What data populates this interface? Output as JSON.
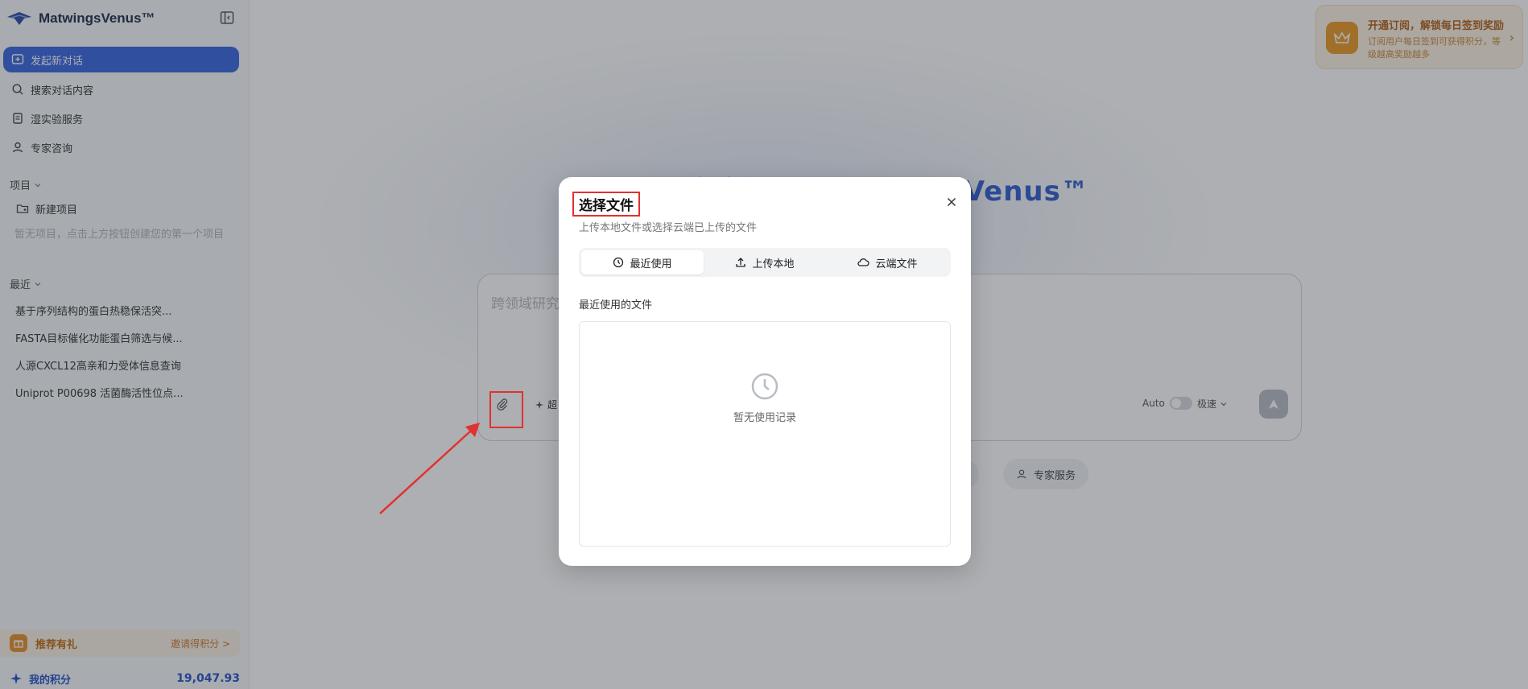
{
  "app": {
    "name": "MatwingsVenus™"
  },
  "sidebar": {
    "nav": [
      {
        "label": "发起新对话",
        "icon": "new-chat-icon"
      },
      {
        "label": "搜索对话内容",
        "icon": "search-icon"
      },
      {
        "label": "湿实验服务",
        "icon": "document-icon"
      },
      {
        "label": "专家咨询",
        "icon": "user-icon"
      }
    ],
    "projects": {
      "heading": "项目",
      "new_label": "新建项目",
      "empty_hint": "暂无项目，点击上方按钮创建您的第一个项目"
    },
    "recent": {
      "heading": "最近",
      "items": [
        "基于序列结构的蛋白热稳保活突...",
        "FASTA目标催化功能蛋白筛选与候...",
        "人源CXCL12高亲和力受体信息查询",
        "Uniprot P00698 活菌酶活性位点..."
      ]
    },
    "referral": {
      "label": "推荐有礼",
      "link": "邀请得积分 >"
    },
    "points": {
      "label": "我的积分",
      "value": "19,047.93"
    }
  },
  "banner": {
    "title": "开通订阅，解锁每日签到奖励",
    "desc": "订阅用户每日签到可获得积分，等级越高奖励越多"
  },
  "main": {
    "title": "欢迎使用 MatwingsVenus™",
    "placeholder": "跨领域研究",
    "deep_label": "超",
    "auto_label": "Auto",
    "speed_label": "极速",
    "chips": [
      "务",
      "专家服务"
    ]
  },
  "modal": {
    "title": "选择文件",
    "subtitle": "上传本地文件或选择云端已上传的文件",
    "tabs": [
      {
        "label": "最近使用",
        "icon": "clock-icon",
        "active": true
      },
      {
        "label": "上传本地",
        "icon": "upload-icon",
        "active": false
      },
      {
        "label": "云端文件",
        "icon": "cloud-icon",
        "active": false
      }
    ],
    "section_label": "最近使用的文件",
    "empty_text": "暂无使用记录"
  },
  "colors": {
    "accent": "#3664e0",
    "annotation": "#e0322f",
    "gold": "#ea9a24"
  }
}
